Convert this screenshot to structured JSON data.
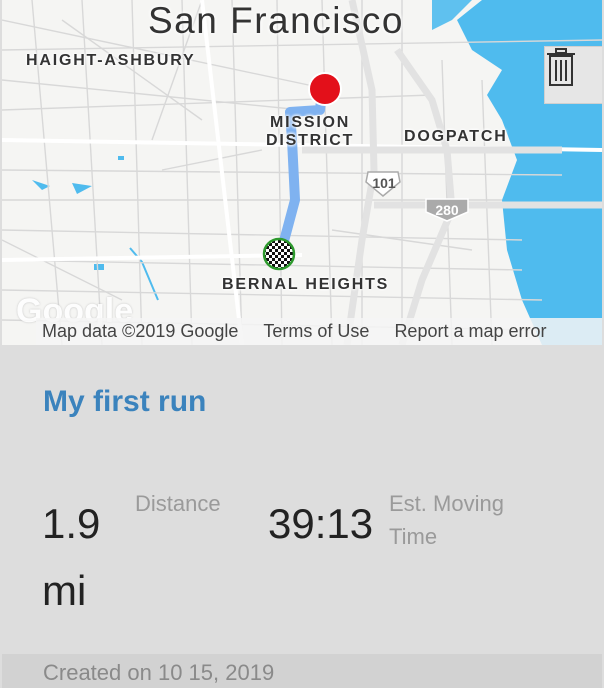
{
  "map": {
    "city": "San Francisco",
    "neighborhoods": {
      "haight_ashbury": "HAIGHT-ASHBURY",
      "mission_line1": "MISSION",
      "mission_line2": "DISTRICT",
      "dogpatch": "DOGPATCH",
      "bernal_heights": "BERNAL HEIGHTS"
    },
    "highways": {
      "us101": "101",
      "i280": "280"
    },
    "logo": "Google",
    "attribution": {
      "map_data": "Map data ©2019 Google",
      "terms": "Terms of Use",
      "report": "Report a map error"
    },
    "route_color": "#7fb2f0",
    "start_marker_color": "#2e9a2e",
    "end_marker_color": "#e3101a",
    "water_color": "#4fbbee"
  },
  "toolbar": {
    "delete_icon": "trash-icon"
  },
  "run": {
    "title": "My first run",
    "distance": {
      "value": "1.9",
      "unit": "mi",
      "label": "Distance"
    },
    "time": {
      "value": "39:13",
      "label_line1": "Est. Moving",
      "label_line2": "Time"
    },
    "created": "Created on 10 15, 2019"
  }
}
